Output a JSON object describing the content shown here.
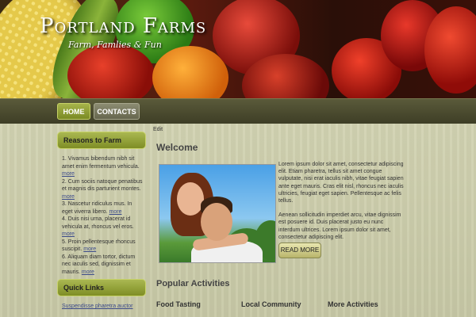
{
  "header": {
    "title": "Portland Farms",
    "subtitle": "Farm, Famlies & Fun"
  },
  "nav": {
    "items": [
      {
        "label": "HOME"
      },
      {
        "label": "CONTACTS"
      }
    ]
  },
  "sidebar": {
    "reasons_title": "Reasons to Farm",
    "reasons": [
      {
        "text": "1. Vivamus bibendum nibh sit amet enim fermentum vehicula.",
        "more": "more"
      },
      {
        "text": "2. Cum sociis natoque penatibus et magnis dis parturient montes.",
        "more": "more"
      },
      {
        "text": "3. Nascetur ridiculus mus. In eget viverra libero.",
        "more": "more"
      },
      {
        "text": "4. Duis nisi urna, placerat id vehicula at, rhoncus vel eros.",
        "more": "more"
      },
      {
        "text": "5. Proin pellentesque rhoncus suscipit.",
        "more": "more"
      },
      {
        "text": "6. Aliquam diam tortor, dictum nec iaculis sed, dignissim et mauris.",
        "more": "more"
      }
    ],
    "quick_title": "Quick Links",
    "quick_links": [
      "Suspendisse pharetra auctor"
    ]
  },
  "main": {
    "edit_label": "Edit",
    "welcome_heading": "Welcome",
    "intro_p1": "Lorem ipsum dolor sit amet, consectetur adipiscing elit. Etiam pharetra, tellus sit amet congue vulputate, nisi erat iaculis nibh, vitae feugiat sapien ante eget mauris. Cras elit nisl, rhoncus nec iaculis ultricies, feugiat eget sapien. Pellentesque ac felis tellus.",
    "intro_p2": "Aenean sollicitudin imperdiet arcu, vitae dignissim est posuere id. Duis placerat justo eu nunc interdum ultrices. Lorem ipsum dolor sit amet, consectetur adipiscing elit.",
    "read_more_label": "READ MORE",
    "popular_heading": "Popular Activities",
    "activities": [
      "Food Tasting",
      "Local Community",
      "More Activities"
    ]
  },
  "colors": {
    "accent": "#8e9d33",
    "nav_bar": "#4a4a30",
    "content_bg": "#cdceac",
    "link": "#3b4a8a"
  }
}
